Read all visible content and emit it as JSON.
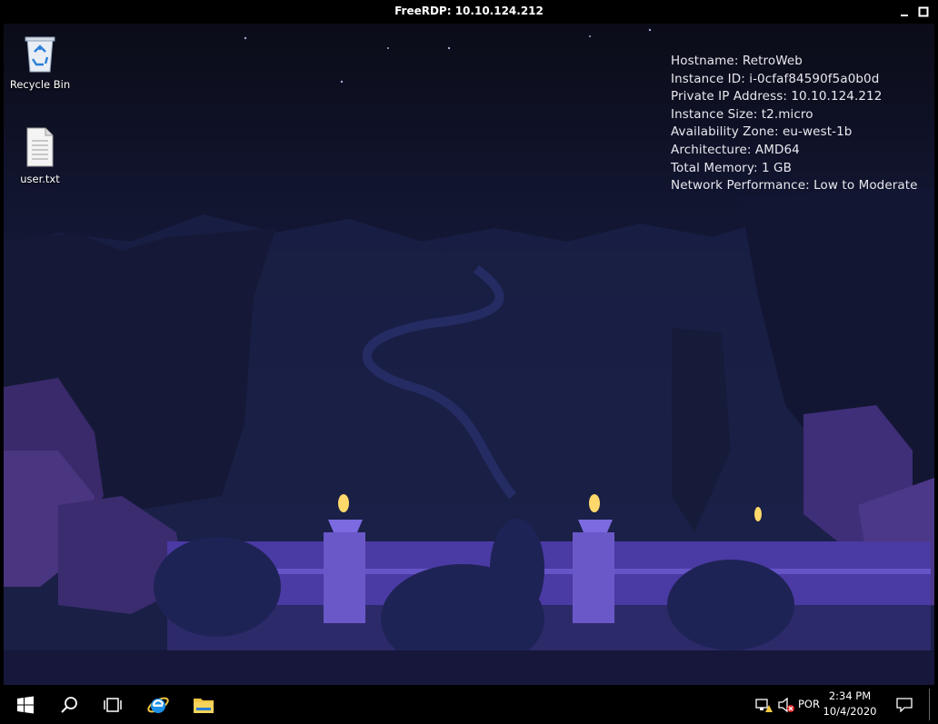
{
  "window": {
    "title": "FreeRDP: 10.10.124.212"
  },
  "desktop": {
    "icons": [
      {
        "label": "Recycle Bin",
        "icon": "recycle-bin-icon"
      },
      {
        "label": "user.txt",
        "icon": "text-file-icon"
      }
    ],
    "sysinfo": [
      "Hostname: RetroWeb",
      "Instance ID: i-0cfaf84590f5a0b0d",
      "Private IP Address: 10.10.124.212",
      "Instance Size: t2.micro",
      "Availability Zone: eu-west-1b",
      "Architecture: AMD64",
      "Total Memory: 1 GB",
      "Network Performance: Low to Moderate"
    ]
  },
  "taskbar": {
    "apps": [
      "start-icon",
      "search-icon",
      "task-view-icon",
      "internet-explorer-icon",
      "file-explorer-icon"
    ],
    "tray": {
      "language": "POR",
      "time": "2:34 PM",
      "date": "10/4/2020"
    }
  },
  "colors": {
    "taskbar": "#000000",
    "text": "#ffffff",
    "ie_blue": "#1e90e6",
    "folder_yellow": "#f2c744"
  }
}
